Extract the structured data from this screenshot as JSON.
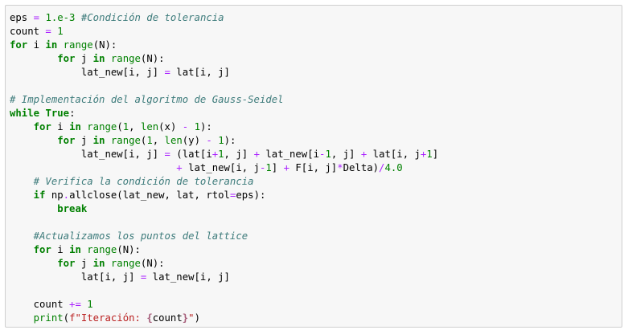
{
  "colors": {
    "background": "#ffffff",
    "cell_background": "#f7f7f7",
    "cell_border": "#cfcfcf",
    "keyword": "#008000",
    "builtin": "#008000",
    "operator": "#aa22ff",
    "number": "#008000",
    "comment": "#3d7b7b",
    "string": "#ba2121",
    "interpolation": "#a45a77",
    "text": "#000000"
  },
  "code_cell": {
    "lines": [
      [
        [
          "tx",
          "eps "
        ],
        [
          "op",
          "="
        ],
        [
          "tx",
          " "
        ],
        [
          "num",
          "1.e-3"
        ],
        [
          "tx",
          " "
        ],
        [
          "cm",
          "#Condición de tolerancia"
        ]
      ],
      [
        [
          "tx",
          "count "
        ],
        [
          "op",
          "="
        ],
        [
          "tx",
          " "
        ],
        [
          "num",
          "1"
        ]
      ],
      [
        [
          "kw",
          "for"
        ],
        [
          "tx",
          " i "
        ],
        [
          "kw",
          "in"
        ],
        [
          "tx",
          " "
        ],
        [
          "bi",
          "range"
        ],
        [
          "tx",
          "(N):"
        ]
      ],
      [
        [
          "tx",
          "        "
        ],
        [
          "kw",
          "for"
        ],
        [
          "tx",
          " j "
        ],
        [
          "kw",
          "in"
        ],
        [
          "tx",
          " "
        ],
        [
          "bi",
          "range"
        ],
        [
          "tx",
          "(N):"
        ]
      ],
      [
        [
          "tx",
          "            lat_new[i, j] "
        ],
        [
          "op",
          "="
        ],
        [
          "tx",
          " lat[i, j]"
        ]
      ],
      [],
      [
        [
          "cm",
          "# Implementación del algoritmo de Gauss-Seidel"
        ]
      ],
      [
        [
          "kw",
          "while"
        ],
        [
          "tx",
          " "
        ],
        [
          "kw",
          "True"
        ],
        [
          "tx",
          ":"
        ]
      ],
      [
        [
          "tx",
          "    "
        ],
        [
          "kw",
          "for"
        ],
        [
          "tx",
          " i "
        ],
        [
          "kw",
          "in"
        ],
        [
          "tx",
          " "
        ],
        [
          "bi",
          "range"
        ],
        [
          "tx",
          "("
        ],
        [
          "num",
          "1"
        ],
        [
          "tx",
          ", "
        ],
        [
          "bi",
          "len"
        ],
        [
          "tx",
          "(x) "
        ],
        [
          "op",
          "-"
        ],
        [
          "tx",
          " "
        ],
        [
          "num",
          "1"
        ],
        [
          "tx",
          "):"
        ]
      ],
      [
        [
          "tx",
          "        "
        ],
        [
          "kw",
          "for"
        ],
        [
          "tx",
          " j "
        ],
        [
          "kw",
          "in"
        ],
        [
          "tx",
          " "
        ],
        [
          "bi",
          "range"
        ],
        [
          "tx",
          "("
        ],
        [
          "num",
          "1"
        ],
        [
          "tx",
          ", "
        ],
        [
          "bi",
          "len"
        ],
        [
          "tx",
          "(y) "
        ],
        [
          "op",
          "-"
        ],
        [
          "tx",
          " "
        ],
        [
          "num",
          "1"
        ],
        [
          "tx",
          "):"
        ]
      ],
      [
        [
          "tx",
          "            lat_new[i, j] "
        ],
        [
          "op",
          "="
        ],
        [
          "tx",
          " (lat[i"
        ],
        [
          "op",
          "+"
        ],
        [
          "num",
          "1"
        ],
        [
          "tx",
          ", j] "
        ],
        [
          "op",
          "+"
        ],
        [
          "tx",
          " lat_new[i"
        ],
        [
          "op",
          "-"
        ],
        [
          "num",
          "1"
        ],
        [
          "tx",
          ", j] "
        ],
        [
          "op",
          "+"
        ],
        [
          "tx",
          " lat[i, j"
        ],
        [
          "op",
          "+"
        ],
        [
          "num",
          "1"
        ],
        [
          "tx",
          "]"
        ]
      ],
      [
        [
          "tx",
          "                            "
        ],
        [
          "op",
          "+"
        ],
        [
          "tx",
          " lat_new[i, j"
        ],
        [
          "op",
          "-"
        ],
        [
          "num",
          "1"
        ],
        [
          "tx",
          "] "
        ],
        [
          "op",
          "+"
        ],
        [
          "tx",
          " F[i, j]"
        ],
        [
          "op",
          "*"
        ],
        [
          "tx",
          "Delta)"
        ],
        [
          "op",
          "/"
        ],
        [
          "num",
          "4.0"
        ]
      ],
      [
        [
          "tx",
          "    "
        ],
        [
          "cm",
          "# Verifica la condición de tolerancia"
        ]
      ],
      [
        [
          "tx",
          "    "
        ],
        [
          "kw",
          "if"
        ],
        [
          "tx",
          " np"
        ],
        [
          "op",
          "."
        ],
        [
          "tx",
          "allclose(lat_new, lat, rtol"
        ],
        [
          "op",
          "="
        ],
        [
          "tx",
          "eps):"
        ]
      ],
      [
        [
          "tx",
          "        "
        ],
        [
          "kw",
          "break"
        ]
      ],
      [],
      [
        [
          "tx",
          "    "
        ],
        [
          "cm",
          "#Actualizamos los puntos del lattice"
        ]
      ],
      [
        [
          "tx",
          "    "
        ],
        [
          "kw",
          "for"
        ],
        [
          "tx",
          " i "
        ],
        [
          "kw",
          "in"
        ],
        [
          "tx",
          " "
        ],
        [
          "bi",
          "range"
        ],
        [
          "tx",
          "(N):"
        ]
      ],
      [
        [
          "tx",
          "        "
        ],
        [
          "kw",
          "for"
        ],
        [
          "tx",
          " j "
        ],
        [
          "kw",
          "in"
        ],
        [
          "tx",
          " "
        ],
        [
          "bi",
          "range"
        ],
        [
          "tx",
          "(N):"
        ]
      ],
      [
        [
          "tx",
          "            lat[i, j] "
        ],
        [
          "op",
          "="
        ],
        [
          "tx",
          " lat_new[i, j]"
        ]
      ],
      [],
      [
        [
          "tx",
          "    count "
        ],
        [
          "op",
          "+="
        ],
        [
          "tx",
          " "
        ],
        [
          "num",
          "1"
        ]
      ],
      [
        [
          "tx",
          "    "
        ],
        [
          "bi",
          "print"
        ],
        [
          "tx",
          "("
        ],
        [
          "str",
          "f\"Iteración: "
        ],
        [
          "si",
          "{"
        ],
        [
          "tx",
          "count"
        ],
        [
          "si",
          "}"
        ],
        [
          "str",
          "\""
        ],
        [
          "tx",
          ")"
        ]
      ]
    ]
  }
}
